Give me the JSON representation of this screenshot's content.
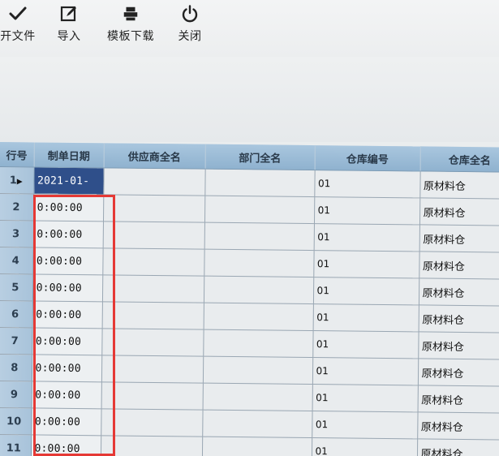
{
  "toolbar": {
    "items": [
      {
        "label": "开文件",
        "icon": "check-icon"
      },
      {
        "label": "导入",
        "icon": "edit-icon"
      },
      {
        "label": "模板下载",
        "icon": "printer-icon"
      },
      {
        "label": "关闭",
        "icon": "power-icon"
      }
    ]
  },
  "grid": {
    "headers": {
      "row": "行号",
      "date": "制单日期",
      "supplier": "供应商全名",
      "dept": "部门全名",
      "wh_code": "仓库编号",
      "wh_name": "仓库全名"
    },
    "rows": [
      {
        "row": "1",
        "date": "2021-01-",
        "wh_code": "01",
        "wh_name": "原材料仓"
      },
      {
        "row": "2",
        "date": "0:00:00",
        "wh_code": "01",
        "wh_name": "原材料仓"
      },
      {
        "row": "3",
        "date": "0:00:00",
        "wh_code": "01",
        "wh_name": "原材料仓"
      },
      {
        "row": "4",
        "date": "0:00:00",
        "wh_code": "01",
        "wh_name": "原材料仓"
      },
      {
        "row": "5",
        "date": "0:00:00",
        "wh_code": "01",
        "wh_name": "原材料仓"
      },
      {
        "row": "6",
        "date": "0:00:00",
        "wh_code": "01",
        "wh_name": "原材料仓"
      },
      {
        "row": "7",
        "date": "0:00:00",
        "wh_code": "01",
        "wh_name": "原材料仓"
      },
      {
        "row": "8",
        "date": "0:00:00",
        "wh_code": "01",
        "wh_name": "原材料仓"
      },
      {
        "row": "9",
        "date": "0:00:00",
        "wh_code": "01",
        "wh_name": "原材料仓"
      },
      {
        "row": "10",
        "date": "0:00:00",
        "wh_code": "01",
        "wh_name": "原材料仓"
      },
      {
        "row": "11",
        "date": "0:00:00",
        "wh_code": "01",
        "wh_name": "原材料仓"
      }
    ]
  },
  "colors": {
    "header_bg": "#9bbbd6",
    "rownum_bg": "#b0c9de",
    "highlight": "#e53935",
    "active_cell": "#2f4f8a"
  }
}
